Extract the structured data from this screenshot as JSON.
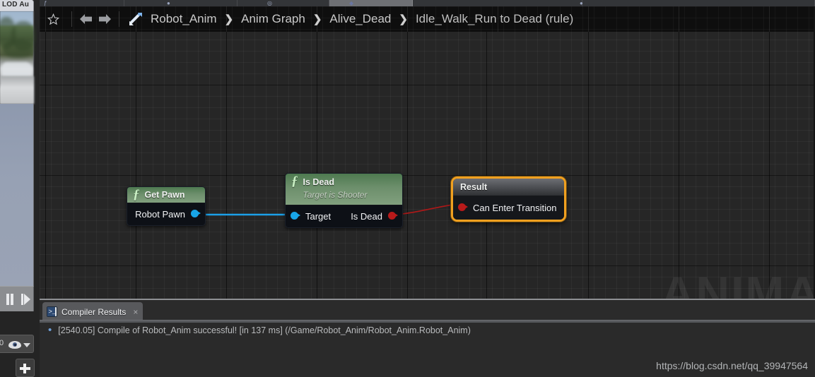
{
  "window": {
    "viewport_tab_label": "LOD Au",
    "url_watermark": "https://blog.csdn.net/qq_39947564",
    "graph_watermark": "ANIMA"
  },
  "breadcrumb": {
    "favorite_icon": "star-icon",
    "back_icon": "arrow-left-icon",
    "forward_icon": "arrow-right-icon",
    "graph_icon": "blueprint-crossing-arrows-icon",
    "separator": "❯",
    "items": [
      {
        "label": "Robot_Anim",
        "name": "breadcrumb-item-robot-anim"
      },
      {
        "label": "Anim Graph",
        "name": "breadcrumb-item-anim-graph"
      },
      {
        "label": "Alive_Dead",
        "name": "breadcrumb-item-alive-dead"
      },
      {
        "label": "Idle_Walk_Run to Dead (rule)",
        "name": "breadcrumb-item-rule"
      }
    ]
  },
  "graph": {
    "nodes": [
      {
        "name": "get-pawn-node",
        "icon": "function-f-icon",
        "title": "Get Pawn",
        "subtitle": "",
        "outputs": [
          {
            "label": "Robot Pawn",
            "pin_color": "#18a5e8",
            "pin_type": "object"
          }
        ],
        "inputs": [],
        "selected": false
      },
      {
        "name": "is-dead-node",
        "icon": "function-f-icon",
        "title": "Is Dead",
        "subtitle": "Target is Shooter",
        "inputs": [
          {
            "label": "Target",
            "pin_color": "#18a5e8",
            "pin_type": "object"
          }
        ],
        "outputs": [
          {
            "label": "Is Dead",
            "pin_color": "#b81a1a",
            "pin_type": "bool"
          }
        ],
        "selected": false
      },
      {
        "name": "result-node",
        "title": "Result",
        "inputs": [
          {
            "label": "Can Enter Transition",
            "pin_color": "#b81a1a",
            "pin_type": "bool"
          }
        ],
        "selected": true,
        "selection_color": "#f0a020"
      }
    ],
    "wires": [
      {
        "name": "wire-robot-pawn-to-target",
        "color": "#1ba0e8"
      },
      {
        "name": "wire-is-dead-to-can-enter-transition",
        "color": "#b01818"
      }
    ]
  },
  "compiler_results": {
    "tab_label": "Compiler Results",
    "tab_icon": "console-icon",
    "close_label": "×",
    "messages": [
      {
        "bullet": "•",
        "text": "[2540.05] Compile of Robot_Anim successful! [in 137 ms] (/Game/Robot_Anim/Robot_Anim.Robot_Anim)"
      }
    ]
  },
  "left_panel": {
    "pause_icon": "pause-icon",
    "step_icon": "step-forward-icon",
    "eye_icon": "eye-icon",
    "dropdown_icon": "chevron-down-icon",
    "add_icon": "plus-icon"
  }
}
